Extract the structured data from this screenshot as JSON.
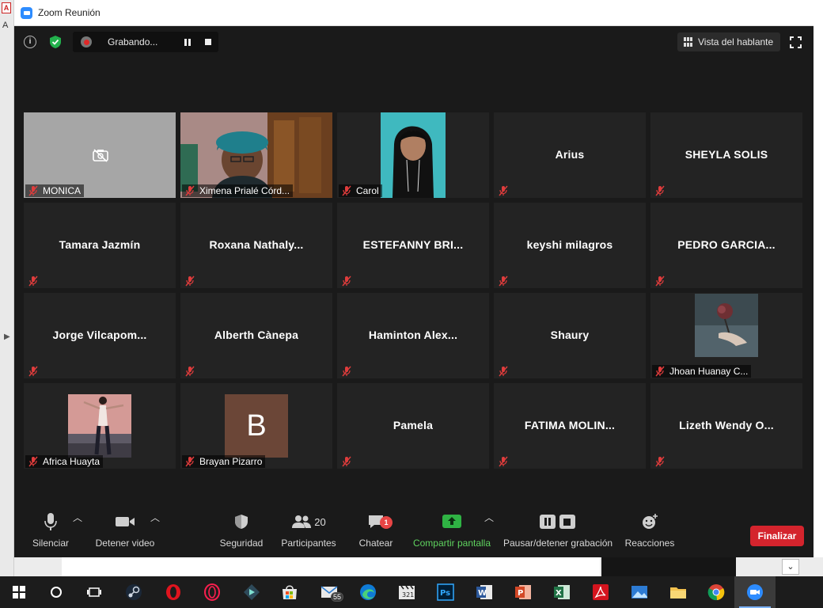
{
  "window": {
    "title": "Zoom Reunión"
  },
  "desktop": {
    "left_label": "A"
  },
  "topbar": {
    "recording_label": "Grabando...",
    "view_label": "Vista del hablante"
  },
  "participants": [
    {
      "name": "MONICA",
      "type": "camera-off",
      "label": "MONICA"
    },
    {
      "name": "Ximena Prialé Córd...",
      "type": "video-ximena",
      "label": "Ximena Prialé Córd..."
    },
    {
      "name": "Carol",
      "type": "video-carol",
      "label": "Carol",
      "active": true
    },
    {
      "name": "Arius",
      "type": "name"
    },
    {
      "name": "SHEYLA SOLIS",
      "type": "name"
    },
    {
      "name": "Tamara Jazmín",
      "type": "name"
    },
    {
      "name": "Roxana  Nathaly...",
      "type": "name"
    },
    {
      "name": "ESTEFANNY  BRI...",
      "type": "name"
    },
    {
      "name": "keyshi milagros",
      "type": "name"
    },
    {
      "name": "PEDRO  GARCIA...",
      "type": "name"
    },
    {
      "name": "Jorge  Vilcapom...",
      "type": "name"
    },
    {
      "name": "Alberth Cànepa",
      "type": "name"
    },
    {
      "name": "Haminton  Alex...",
      "type": "name"
    },
    {
      "name": "Shaury",
      "type": "name"
    },
    {
      "name": "Jhoan Huanay C...",
      "type": "photo-rose",
      "label": "Jhoan Huanay C..."
    },
    {
      "name": "Africa Huayta",
      "type": "photo-girl",
      "label": "Africa Huayta"
    },
    {
      "name": "Brayan Pizarro",
      "type": "avatar-letter",
      "letter": "B",
      "label": "Brayan Pizarro"
    },
    {
      "name": "Pamela",
      "type": "name"
    },
    {
      "name": "FATIMA  MOLIN...",
      "type": "name"
    },
    {
      "name": "Lizeth  Wendy  O...",
      "type": "name"
    }
  ],
  "footer": {
    "mute": "Silenciar",
    "video": "Detener video",
    "security": "Seguridad",
    "participants": "Participantes",
    "participants_count": "20",
    "chat": "Chatear",
    "chat_badge": "1",
    "share": "Compartir pantalla",
    "record": "Pausar/detener grabación",
    "reactions": "Reacciones",
    "end": "Finalizar"
  },
  "taskbar": {
    "mail_badge": "55",
    "icons": [
      "windows-start-icon",
      "cortana-icon",
      "task-view-icon",
      "steam-icon",
      "opera-icon",
      "opera-gx-icon",
      "filmora-icon",
      "store-icon",
      "mail-icon",
      "edge-icon",
      "clapper-icon",
      "photoshop-icon",
      "word-icon",
      "powerpoint-icon",
      "excel-icon",
      "acrobat-icon",
      "photos-icon",
      "explorer-icon",
      "chrome-icon",
      "zoom-icon"
    ]
  },
  "colors": {
    "active_speaker": "#d7e96b",
    "end_button": "#d4242d",
    "share_green": "#5fd35f",
    "zoom_blue": "#2d8cff"
  }
}
